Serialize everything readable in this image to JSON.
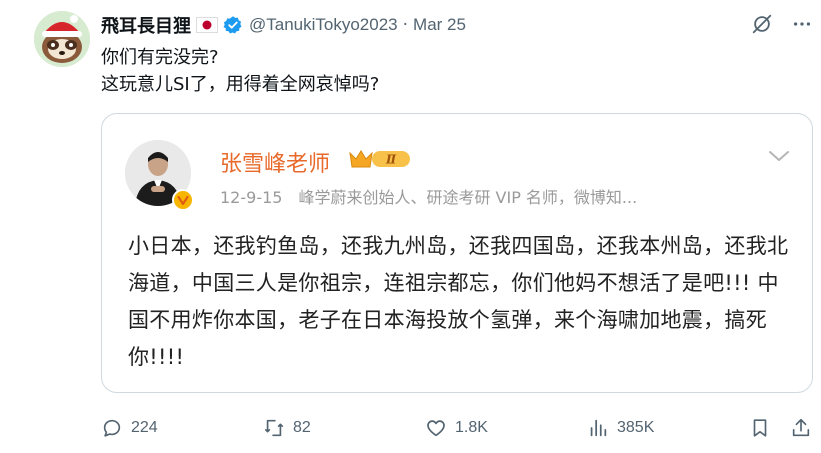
{
  "author": {
    "display_name": "飛耳長目狸",
    "handle": "@TanukiTokyo2023",
    "separator": "·",
    "date": "Mar 25",
    "flag_icon": "japan-flag-icon",
    "verified_icon": "verified-badge-icon",
    "verified_color": "#1d9bf0"
  },
  "tweet": {
    "line1": "你们有完没完?",
    "line2": "这玩意儿SI了，用得着全网哀悼吗?"
  },
  "embedded": {
    "name": "张雪峰老师",
    "vip_label": "Ⅱ",
    "meta": "12-9-15　峰学蔚来创始人、研途考研 VIP 名师，微博知...",
    "body": "小日本，还我钓鱼岛，还我九州岛，还我四国岛，还我本州岛，还我北海道，中国三人是你祖宗，连祖宗都忘，你们他妈不想活了是吧!!! 中国不用炸你本国，老子在日本海投放个氢弹，来个海啸加地震，搞死你!!!!",
    "name_color": "#e8692a"
  },
  "actions": {
    "replies": "224",
    "retweets": "82",
    "likes": "1.8K",
    "views": "385K"
  },
  "colors": {
    "text": "#0f1419",
    "secondary": "#536471",
    "border": "#cfd9de"
  }
}
